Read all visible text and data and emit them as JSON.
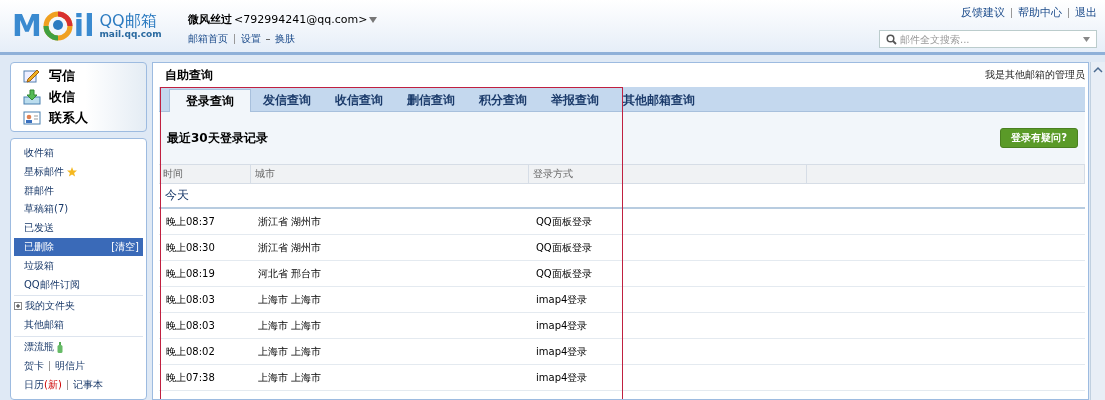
{
  "header": {
    "logo": {
      "left": "M",
      "right": "il",
      "brand": "QQ邮箱",
      "domain": "mail.qq.com"
    },
    "user": {
      "name": "微风丝过",
      "email": "<792994241@qq.com>"
    },
    "user_links": [
      "邮箱首页",
      "设置",
      "换肤"
    ],
    "top_links": [
      "反馈建议",
      "帮助中心",
      "退出"
    ],
    "search": {
      "placeholder": "邮件全文搜索..."
    }
  },
  "sidebar": {
    "actions": [
      {
        "label": "写信",
        "kind": "write"
      },
      {
        "label": "收信",
        "kind": "receive"
      },
      {
        "label": "联系人",
        "kind": "contacts"
      }
    ],
    "groups": [
      [
        {
          "kind": "folder",
          "label": "收件箱",
          "selected": false
        },
        {
          "kind": "starred",
          "label": "星标邮件",
          "selected": false
        },
        {
          "kind": "folder",
          "label": "群邮件",
          "selected": false
        },
        {
          "kind": "folder",
          "label": "草稿箱(7)",
          "selected": false
        },
        {
          "kind": "folder",
          "label": "已发送",
          "selected": false
        },
        {
          "kind": "folder",
          "label": "已删除",
          "selected": true,
          "action": "[清空]"
        },
        {
          "kind": "folder",
          "label": "垃圾箱",
          "selected": false
        },
        {
          "kind": "folder",
          "label": "QQ邮件订阅",
          "selected": false
        }
      ],
      [
        {
          "kind": "tree",
          "label": "我的文件夹",
          "expanded": false
        },
        {
          "kind": "folder",
          "label": "其他邮箱",
          "selected": false
        }
      ],
      [
        {
          "kind": "bottle",
          "label": "漂流瓶",
          "selected": false
        },
        {
          "kind": "pair",
          "links": [
            {
              "label": "贺卡"
            },
            {
              "label": "明信片"
            }
          ]
        },
        {
          "kind": "pair",
          "links": [
            {
              "label": "日历",
              "badge": "(新)"
            },
            {
              "label": "记事本"
            }
          ]
        }
      ]
    ]
  },
  "main": {
    "title": "自助查询",
    "admin_link": "我是其他邮箱的管理员",
    "tabs": [
      {
        "label": "登录查询",
        "selected": true
      },
      {
        "label": "发信查询",
        "selected": false
      },
      {
        "label": "收信查询",
        "selected": false
      },
      {
        "label": "删信查询",
        "selected": false
      },
      {
        "label": "积分查询",
        "selected": false
      },
      {
        "label": "举报查询",
        "selected": false
      },
      {
        "label": "其他邮箱查询",
        "selected": false
      }
    ],
    "section_title": "最近30天登录记录",
    "help_button": "登录有疑问?",
    "columns": [
      "时间",
      "城市",
      "登录方式"
    ],
    "group": "今天",
    "rows": [
      [
        "晚上08:37",
        "浙江省 湖州市",
        "QQ面板登录"
      ],
      [
        "晚上08:30",
        "浙江省 湖州市",
        "QQ面板登录"
      ],
      [
        "晚上08:19",
        "河北省 邢台市",
        "QQ面板登录"
      ],
      [
        "晚上08:03",
        "上海市 上海市",
        "imap4登录"
      ],
      [
        "晚上08:03",
        "上海市 上海市",
        "imap4登录"
      ],
      [
        "晚上08:02",
        "上海市 上海市",
        "imap4登录"
      ],
      [
        "晚上07:38",
        "上海市 上海市",
        "imap4登录"
      ]
    ]
  }
}
